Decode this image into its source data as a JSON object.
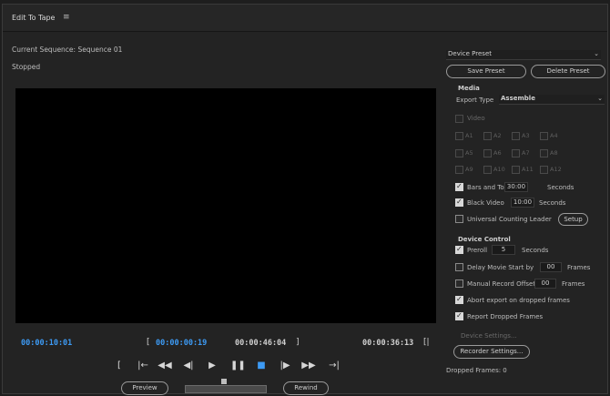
{
  "window": {
    "title": "Edit To Tape",
    "menu_icon": "≡"
  },
  "left": {
    "sequence": "Current Sequence: Sequence 01",
    "status": "Stopped",
    "timecodes": {
      "current": "00:00:10:01",
      "in_bracket": "[",
      "in": "00:00:00:19",
      "out": "00:00:46:04",
      "out_bracket": "]",
      "duration": "00:00:36:13",
      "end_marker": "[|"
    },
    "transport": [
      "[",
      "|←",
      "◀◀",
      "◀|",
      "▶",
      "❚❚",
      "■",
      "|▶",
      "▶▶",
      "→|"
    ],
    "preview_label": "Preview",
    "rewind_label": "Rewind"
  },
  "right": {
    "device_preset_label": "Device Preset",
    "save_preset": "Save Preset",
    "delete_preset": "Delete Preset",
    "media_label": "Media",
    "export_type_label": "Export Type",
    "export_type_value": "Assemble",
    "video_label": "Video",
    "tracks": [
      "A1",
      "A2",
      "A3",
      "A4",
      "A5",
      "A6",
      "A7",
      "A8",
      "A9",
      "A10",
      "A11",
      "A12"
    ],
    "rows": {
      "bars_tone_label": "Bars and Tone",
      "bars_tone_value": "30:00",
      "bars_tone_unit": "Seconds",
      "black_label": "Black Video",
      "black_value": "10:00",
      "black_unit": "Seconds",
      "leader_label": "Universal Counting Leader",
      "leader_button": "Setup"
    },
    "device_control_label": "Device Control",
    "preroll_label": "Preroll",
    "preroll_value": "5",
    "preroll_unit": "Seconds",
    "delay_label": "Delay Movie Start by",
    "delay_value": "00",
    "delay_unit": "Frames",
    "offset_label": "Manual Record Offset",
    "offset_value": "00",
    "offset_unit": "Frames",
    "abort_label": "Abort export on dropped frames",
    "report_label": "Report Dropped Frames",
    "device_settings_label": "Device Settings...",
    "recorder_settings_label": "Recorder Settings...",
    "dropped_frames": "Dropped Frames: 0"
  }
}
